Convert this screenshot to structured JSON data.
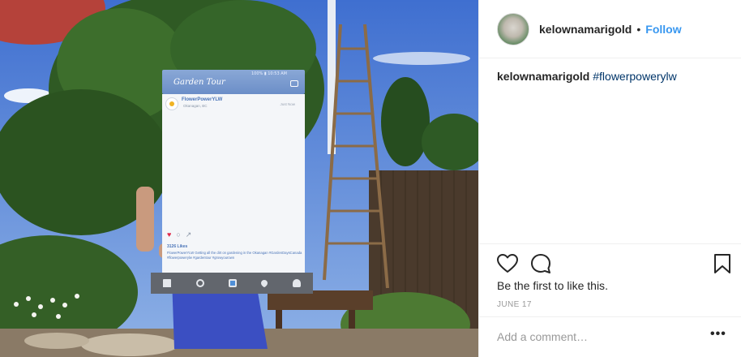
{
  "post": {
    "image_alt": "Woman in a red hat holding an Instagram-style 'Garden Tour' photo frame prop in a garden",
    "sign": {
      "status": "100% ▮ 10:53 AM",
      "title": "Garden Tour",
      "username": "FlowerPowerYLW",
      "location": "Okanagan, BC",
      "timestamp": "Just Now",
      "likes": "3126 Likes",
      "caption": "FlowerPowerYLW Getting all the dirt on gardening in the Okanagan #GardenDaysCanada #flowerpowerylw #gardentour #growyourown"
    }
  },
  "sidebar": {
    "header": {
      "username": "kelownamarigold",
      "separator": "•",
      "follow_label": "Follow",
      "avatar_icon": "profile-avatar"
    },
    "caption": {
      "username": "kelownamarigold",
      "hashtag": "#flowerpowerylw"
    },
    "actions": {
      "like_icon": "heart-icon",
      "comment_icon": "comment-icon",
      "save_icon": "bookmark-icon"
    },
    "likes": {
      "prefix": "Be the first to ",
      "link": "like this",
      "suffix": "."
    },
    "date": "JUNE 17",
    "comment": {
      "placeholder": "Add a comment…",
      "more_label": "•••"
    }
  },
  "colors": {
    "follow_blue": "#3897f0",
    "hashtag": "#003569",
    "muted": "#999999"
  }
}
